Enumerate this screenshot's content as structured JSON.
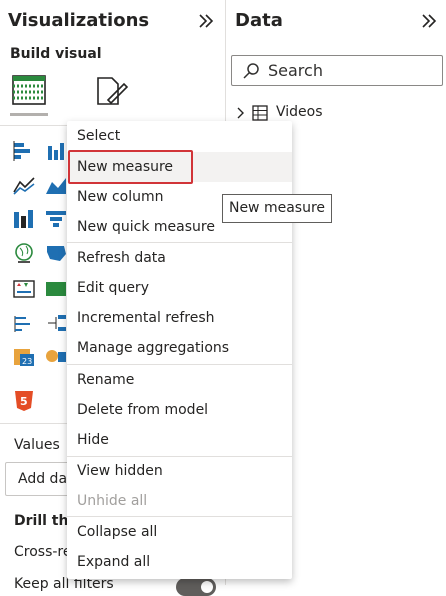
{
  "viz": {
    "title": "Visualizations",
    "collapse_icon": "double-chevron-right-icon",
    "build_visual": "Build visual",
    "values_label": "Values",
    "add_data_text": "Add da",
    "drill_label": "Drill thr",
    "cross_label": "Cross-re",
    "keep_filters": "Keep all filters"
  },
  "data_pane": {
    "title": "Data",
    "collapse_icon": "double-chevron-right-icon",
    "search_placeholder": "Search",
    "tree_item": "Videos"
  },
  "context_menu": {
    "items": [
      {
        "label": "Select"
      },
      {
        "label": "New measure"
      },
      {
        "label": "New column"
      },
      {
        "label": "New quick measure"
      },
      {
        "label": "Refresh data"
      },
      {
        "label": "Edit query"
      },
      {
        "label": "Incremental refresh"
      },
      {
        "label": "Manage aggregations"
      },
      {
        "label": "Rename"
      },
      {
        "label": "Delete from model"
      },
      {
        "label": "Hide"
      },
      {
        "label": "View hidden"
      },
      {
        "label": "Unhide all"
      },
      {
        "label": "Collapse all"
      },
      {
        "label": "Expand all"
      }
    ]
  },
  "tooltip": {
    "text": "New measure"
  },
  "colors": {
    "accent_red": "#d13438",
    "hover_bg": "#f3f2f1",
    "separator": "#e1dfdd"
  }
}
